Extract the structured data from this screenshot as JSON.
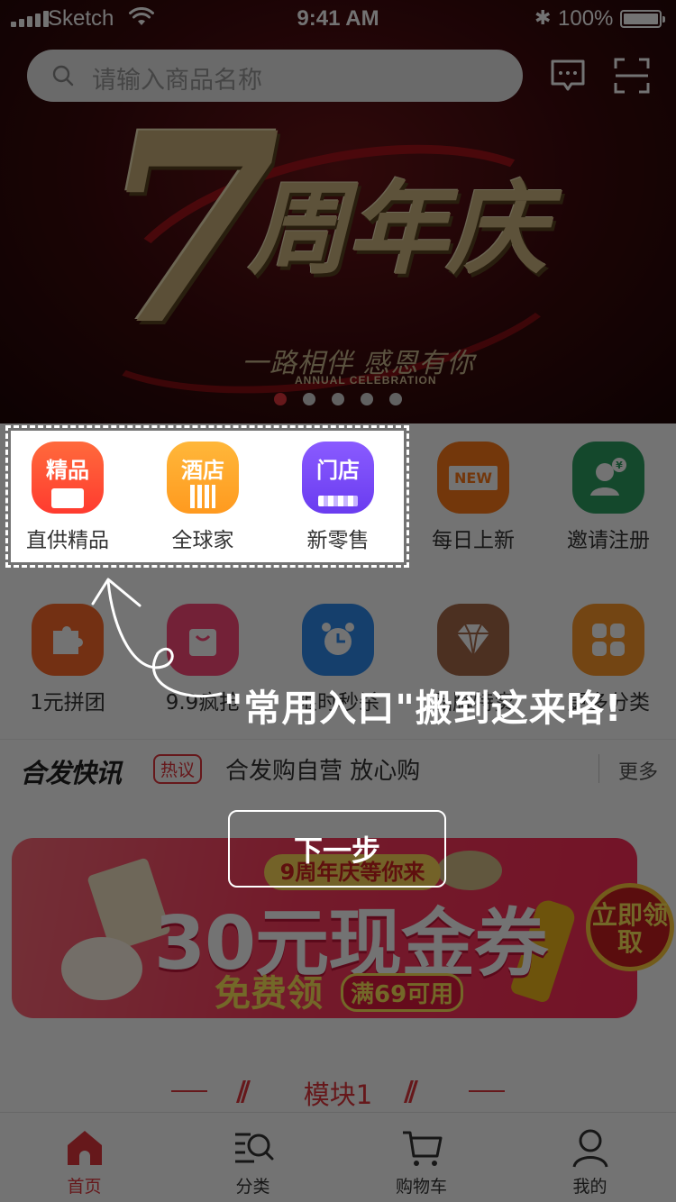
{
  "status_bar": {
    "carrier": "Sketch",
    "time": "9:41 AM",
    "bluetooth": "✱",
    "battery": "100%"
  },
  "search": {
    "placeholder": "请输入商品名称"
  },
  "banner": {
    "hero_number": "7",
    "hero_title": "周年庆",
    "slogan": "一路相伴 感恩有你",
    "subtitle_en": "ANNUAL CELEBRATION",
    "slides_total": 5,
    "active_slide": 1
  },
  "quick_entries": [
    {
      "label": "直供精品",
      "badge": "精品",
      "icon": "shopping-bag-icon",
      "color": "#ff5a3c"
    },
    {
      "label": "全球家",
      "badge": "酒店",
      "icon": "hotel-building-icon",
      "color": "#ffa726"
    },
    {
      "label": "新零售",
      "badge": "门店",
      "icon": "storefront-icon",
      "color": "#7b4dff"
    },
    {
      "label": "每日上新",
      "badge": "NEW",
      "icon": "new-sign-icon",
      "color": "#ff7a1a"
    },
    {
      "label": "邀请注册",
      "badge": "¥",
      "icon": "invite-user-icon",
      "color": "#2e9f63"
    },
    {
      "label": "1元拼团",
      "badge": "",
      "icon": "puzzle-icon",
      "color": "#ff6a2a"
    },
    {
      "label": "9.9疯抢",
      "badge": "",
      "icon": "shopping-bag-icon",
      "color": "#ff4a7a"
    },
    {
      "label": "限时秒杀",
      "badge": "",
      "icon": "alarm-clock-icon",
      "color": "#2f8cf0"
    },
    {
      "label": "品牌特卖",
      "badge": "",
      "icon": "diamond-icon",
      "color": "#a86a4a"
    },
    {
      "label": "更多分类",
      "badge": "",
      "icon": "grid-icon",
      "color": "#ff9a2a"
    }
  ],
  "news": {
    "brand": "合发快讯",
    "tag": "热议",
    "headline": "合发购自营 放心购",
    "more": "更多"
  },
  "promo": {
    "subtitle": "9周年庆等你来",
    "amount": "30元现金券",
    "free_label": "免费领",
    "condition": "满69可用",
    "cta": "立即领取"
  },
  "section": {
    "title": "模块1"
  },
  "tabbar": [
    {
      "label": "首页",
      "icon": "home-icon",
      "active": true
    },
    {
      "label": "分类",
      "icon": "category-search-icon",
      "active": false
    },
    {
      "label": "购物车",
      "icon": "cart-icon",
      "active": false
    },
    {
      "label": "我的",
      "icon": "profile-icon",
      "active": false
    }
  ],
  "guide": {
    "message": "\"常用入口\"搬到这来咯!",
    "next_button": "下一步"
  },
  "colors": {
    "accent": "#e3353c",
    "overlay": "rgba(0,0,0,0.55)"
  }
}
